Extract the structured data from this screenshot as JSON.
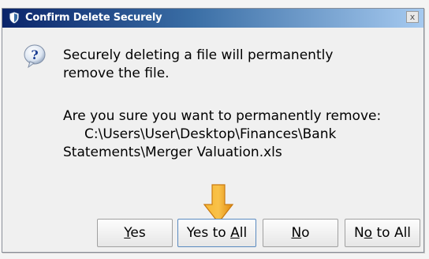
{
  "dialog": {
    "title": "Confirm Delete Securely",
    "close_label": "x",
    "message_line1": "Securely deleting a file will permanently",
    "message_line2": "remove the file.",
    "prompt_line1": "Are you sure you want to permanently remove:",
    "prompt_line2": "     C:\\Users\\User\\Desktop\\Finances\\Bank",
    "prompt_line3": "Statements\\Merger Valuation.xls"
  },
  "buttons": {
    "yes": {
      "accel": "Y",
      "rest": "es"
    },
    "yes_to_all": {
      "pre": "Yes to ",
      "accel": "A",
      "rest": "ll"
    },
    "no": {
      "accel": "N",
      "rest": "o"
    },
    "no_to_all": {
      "pre": "N",
      "accel": "o",
      "rest": " to All"
    }
  },
  "colors": {
    "titlebar_start": "#0a246a",
    "titlebar_end": "#a6caf0",
    "arrow": "#f0a020"
  },
  "icons": {
    "app": "shield-icon",
    "message": "question-icon",
    "pointer": "down-arrow-icon"
  }
}
